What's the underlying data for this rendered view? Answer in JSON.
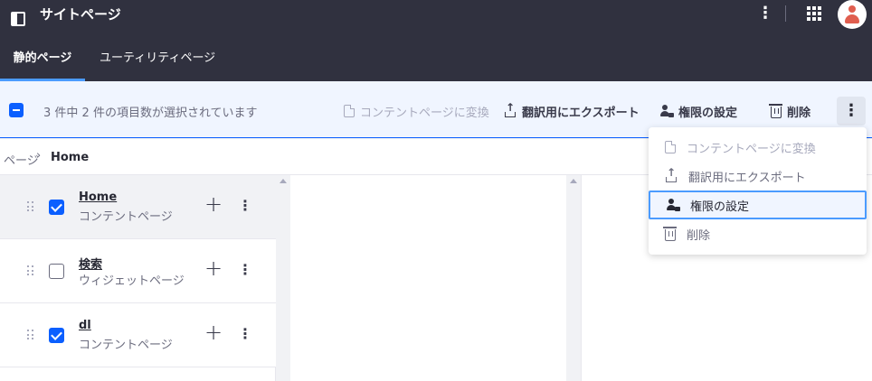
{
  "app": {
    "title": "サイトページ"
  },
  "tabs": [
    {
      "label": "静的ページ",
      "active": true
    },
    {
      "label": "ユーティリティページ",
      "active": false
    }
  ],
  "toolbar": {
    "selection_text": "3 件中 2 件の項目数が選択されています",
    "convert_label": "コンテントページに変換",
    "export_label": "翻訳用にエクスポート",
    "permissions_label": "権限の設定",
    "delete_label": "削除"
  },
  "breadcrumb": {
    "parent": "ページ",
    "separator": "›",
    "current": "Home"
  },
  "pages": [
    {
      "title": "Home",
      "type": "コンテントページ",
      "checked": true
    },
    {
      "title": "検索",
      "type": "ウィジェットページ",
      "checked": false
    },
    {
      "title": "dl",
      "type": "コンテントページ",
      "checked": true
    }
  ],
  "dropdown": {
    "items": [
      {
        "label": "コンテントページに変換",
        "icon": "page-icon",
        "state": "disabled"
      },
      {
        "label": "翻訳用にエクスポート",
        "icon": "export-icon",
        "state": "normal"
      },
      {
        "label": "権限の設定",
        "icon": "permissions-icon",
        "state": "focused"
      },
      {
        "label": "削除",
        "icon": "trash-icon",
        "state": "normal"
      }
    ]
  },
  "colors": {
    "topbar": "#30313f",
    "accent": "#0b5fff",
    "toolbar_bg": "#f0f5ff"
  }
}
